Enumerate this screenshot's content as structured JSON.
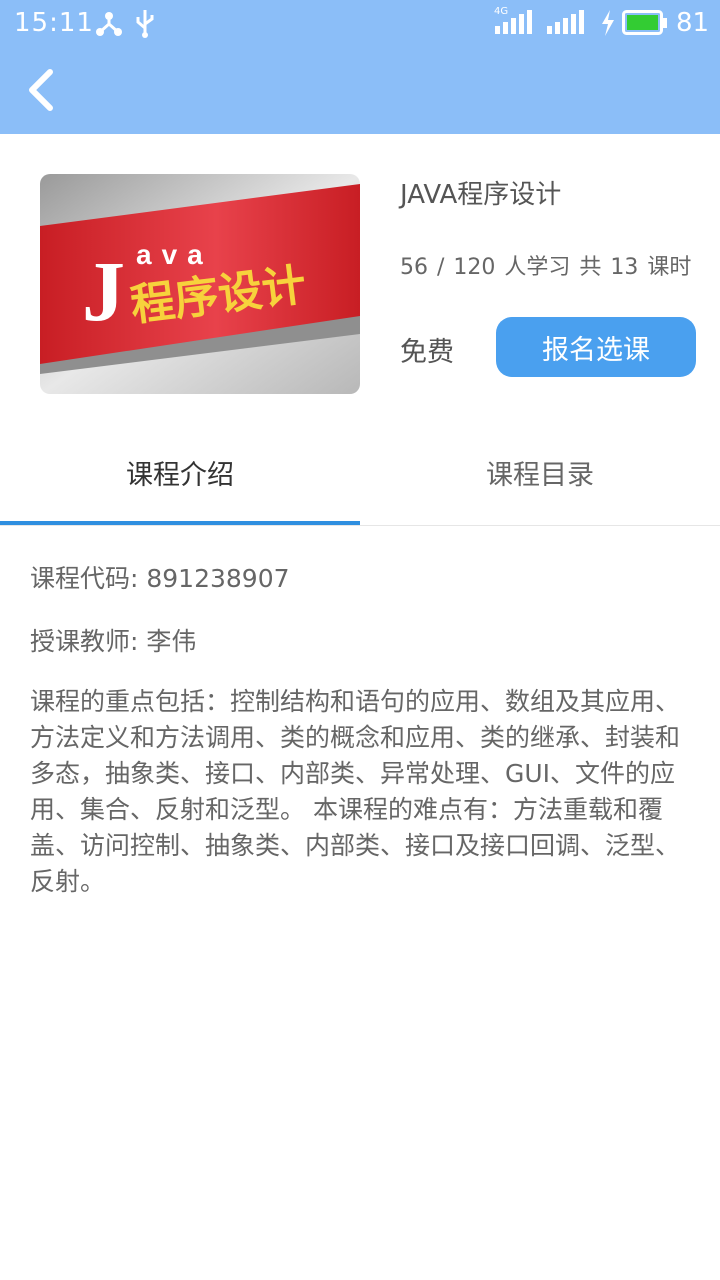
{
  "status_bar": {
    "time": "15:11",
    "network": "4G",
    "battery": "81",
    "colors": {
      "bar": "#8bbef8",
      "battery_fill": "#33cc33"
    },
    "icons": [
      "usb-tether-icon",
      "usb-icon",
      "signal-4g-icon",
      "signal-icon",
      "charging-icon",
      "battery-icon"
    ]
  },
  "header": {
    "back_icon": "chevron-left-icon"
  },
  "course": {
    "cover": {
      "word_top": "ava",
      "word_initial": "J",
      "word_main": "程序设计"
    },
    "title": "JAVA程序设计",
    "stats": "56 / 120 人学习   共 13 课时",
    "price": "免费",
    "enroll_label": "报名选课",
    "accent_color": "#4aa0ef"
  },
  "tabs": [
    {
      "label": "课程介绍",
      "active": true
    },
    {
      "label": "课程目录",
      "active": false
    }
  ],
  "intro": {
    "code": "课程代码: 891238907",
    "teacher": "授课教师: 李伟",
    "description": "课程的重点包括：控制结构和语句的应用、数组及其应用、方法定义和方法调用、类的概念和应用、类的继承、封装和多态，抽象类、接口、内部类、异常处理、GUI、文件的应用、集合、反射和泛型。 本课程的难点有：方法重载和覆盖、访问控制、抽象类、内部类、接口及接口回调、泛型、反射。"
  }
}
